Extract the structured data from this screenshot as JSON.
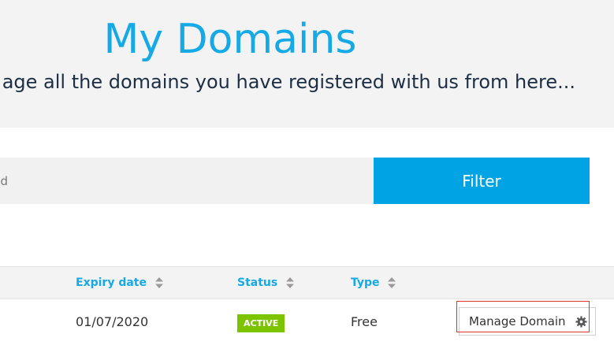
{
  "hero": {
    "title": "My Domains",
    "subtitle": "age all the domains you have registered with us from here..."
  },
  "filter": {
    "placeholder": "nd",
    "button_label": "Filter"
  },
  "table": {
    "columns": [
      {
        "label": "Expiry date"
      },
      {
        "label": "Status"
      },
      {
        "label": "Type"
      }
    ],
    "rows": [
      {
        "expiry": "01/07/2020",
        "status": "ACTIVE",
        "type": "Free",
        "action_label": "Manage Domain"
      }
    ]
  },
  "icons": {
    "sort": "sort-icon",
    "gear": "gear-icon"
  },
  "colors": {
    "accent": "#15a9e6",
    "filter_button": "#00a4e4",
    "active_badge": "#7cc400",
    "highlight": "#d33a2c"
  }
}
